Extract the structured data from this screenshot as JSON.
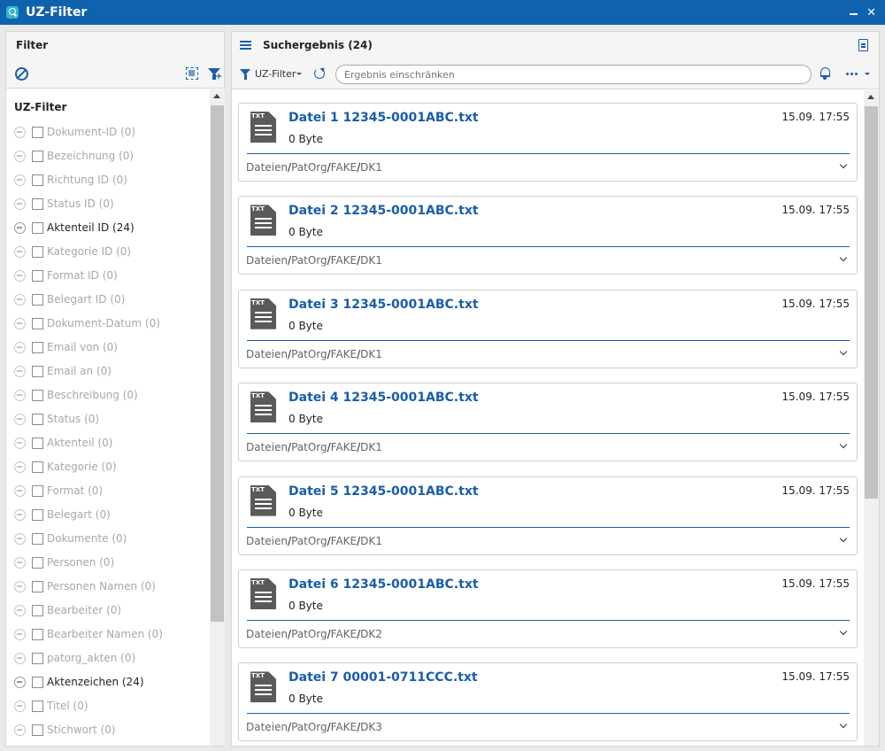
{
  "window": {
    "title": "UZ-Filter"
  },
  "left": {
    "header": "Filter",
    "group_title": "UZ-Filter",
    "items": [
      {
        "label": "Dokument-ID (0)",
        "active": false
      },
      {
        "label": "Bezeichnung (0)",
        "active": false
      },
      {
        "label": "Richtung ID (0)",
        "active": false
      },
      {
        "label": "Status ID (0)",
        "active": false
      },
      {
        "label": "Aktenteil ID (24)",
        "active": true
      },
      {
        "label": "Kategorie ID (0)",
        "active": false
      },
      {
        "label": "Format ID (0)",
        "active": false
      },
      {
        "label": "Belegart ID (0)",
        "active": false
      },
      {
        "label": "Dokument-Datum (0)",
        "active": false
      },
      {
        "label": "Email von (0)",
        "active": false
      },
      {
        "label": "Email an (0)",
        "active": false
      },
      {
        "label": "Beschreibung (0)",
        "active": false
      },
      {
        "label": "Status (0)",
        "active": false
      },
      {
        "label": "Aktenteil (0)",
        "active": false
      },
      {
        "label": "Kategorie (0)",
        "active": false
      },
      {
        "label": "Format (0)",
        "active": false
      },
      {
        "label": "Belegart (0)",
        "active": false
      },
      {
        "label": "Dokumente (0)",
        "active": false
      },
      {
        "label": "Personen (0)",
        "active": false
      },
      {
        "label": "Personen Namen (0)",
        "active": false
      },
      {
        "label": "Bearbeiter (0)",
        "active": false
      },
      {
        "label": "Bearbeiter Namen (0)",
        "active": false
      },
      {
        "label": "patorg_akten (0)",
        "active": false
      },
      {
        "label": "Aktenzeichen (24)",
        "active": true
      },
      {
        "label": "Titel (0)",
        "active": false
      },
      {
        "label": "Stichwort (0)",
        "active": false
      }
    ]
  },
  "right": {
    "header": "Suchergebnis (24)",
    "filter_label": "UZ-Filter",
    "search_placeholder": "Ergebnis einschränken",
    "results": [
      {
        "name": "Datei 1 12345-0001ABC.txt",
        "date": "15.09. 17:55",
        "size": "0 Byte",
        "ext": "TXT",
        "path": [
          "Dateien",
          "PatOrg",
          "FAKE",
          "DK1"
        ]
      },
      {
        "name": "Datei 2 12345-0001ABC.txt",
        "date": "15.09. 17:55",
        "size": "0 Byte",
        "ext": "TXT",
        "path": [
          "Dateien",
          "PatOrg",
          "FAKE",
          "DK1"
        ]
      },
      {
        "name": "Datei 3 12345-0001ABC.txt",
        "date": "15.09. 17:55",
        "size": "0 Byte",
        "ext": "TXT",
        "path": [
          "Dateien",
          "PatOrg",
          "FAKE",
          "DK1"
        ]
      },
      {
        "name": "Datei 4 12345-0001ABC.txt",
        "date": "15.09. 17:55",
        "size": "0 Byte",
        "ext": "TXT",
        "path": [
          "Dateien",
          "PatOrg",
          "FAKE",
          "DK1"
        ]
      },
      {
        "name": "Datei 5 12345-0001ABC.txt",
        "date": "15.09. 17:55",
        "size": "0 Byte",
        "ext": "TXT",
        "path": [
          "Dateien",
          "PatOrg",
          "FAKE",
          "DK1"
        ]
      },
      {
        "name": "Datei 6 12345-0001ABC.txt",
        "date": "15.09. 17:55",
        "size": "0 Byte",
        "ext": "TXT",
        "path": [
          "Dateien",
          "PatOrg",
          "FAKE",
          "DK2"
        ]
      },
      {
        "name": "Datei 7 00001-0711CCC.txt",
        "date": "15.09. 17:55",
        "size": "0 Byte",
        "ext": "TXT",
        "path": [
          "Dateien",
          "PatOrg",
          "FAKE",
          "DK3"
        ]
      }
    ]
  },
  "colors": {
    "titlebar": "#0f62ad",
    "accent": "#1a5ea8"
  },
  "icons": [
    "app-search-icon",
    "minimize-icon",
    "close-icon",
    "reset-filter-icon",
    "select-all-icon",
    "add-filter-icon",
    "menu-icon",
    "document-icon",
    "filter-icon",
    "refresh-icon",
    "bell-icon",
    "more-icon",
    "txt-file-icon",
    "chevron-down-icon"
  ]
}
